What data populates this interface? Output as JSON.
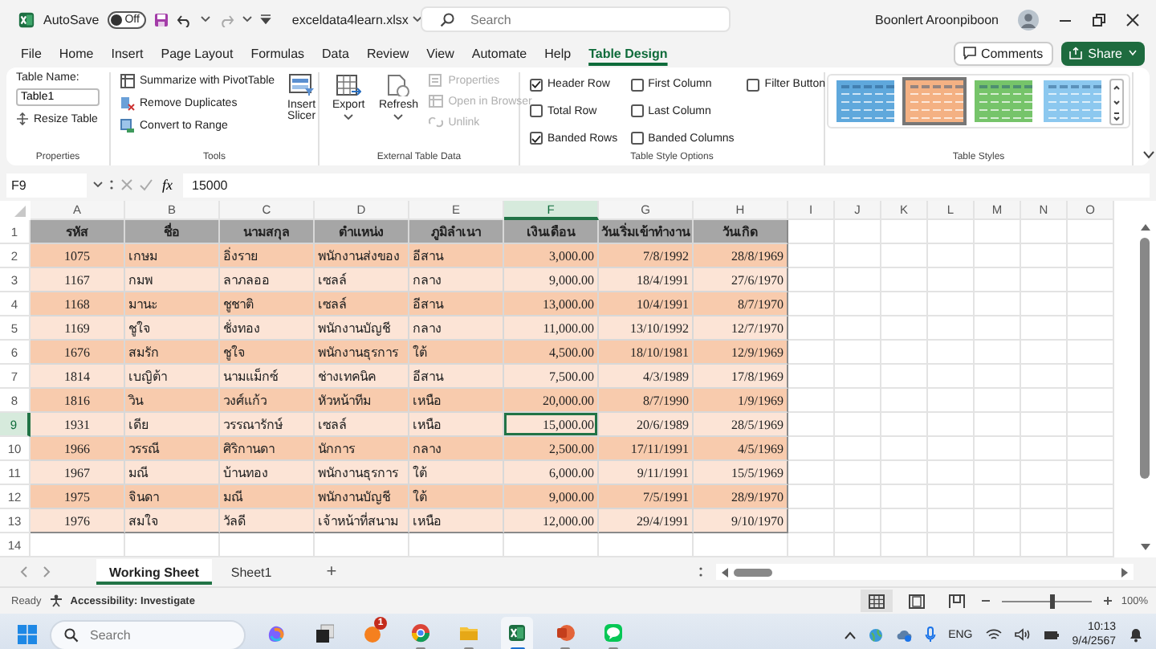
{
  "title_bar": {
    "autosave_label": "AutoSave",
    "autosave": {
      "label": "Off",
      "on": false
    },
    "filename": "exceldata4learn.xlsx",
    "search": {
      "placeholder": "Search"
    },
    "user": "Boonlert Aroonpiboon"
  },
  "menu_tabs": [
    {
      "label": "File",
      "selected": false
    },
    {
      "label": "Home",
      "selected": false
    },
    {
      "label": "Insert",
      "selected": false
    },
    {
      "label": "Page Layout",
      "selected": false
    },
    {
      "label": "Formulas",
      "selected": false
    },
    {
      "label": "Data",
      "selected": false
    },
    {
      "label": "Review",
      "selected": false
    },
    {
      "label": "View",
      "selected": false
    },
    {
      "label": "Automate",
      "selected": false
    },
    {
      "label": "Help",
      "selected": false
    },
    {
      "label": "Table Design",
      "selected": true
    }
  ],
  "actions": {
    "comments": "Comments",
    "share": "Share"
  },
  "ribbon": {
    "properties": {
      "table_name_label": "Table Name:",
      "table_name": "Table1",
      "resize": "Resize Table",
      "group": "Properties"
    },
    "tools": {
      "items": [
        "Summarize with PivotTable",
        "Remove Duplicates",
        "Convert to Range"
      ],
      "slicer": "Insert Slicer",
      "group": "Tools"
    },
    "external": {
      "buttons": [
        "Export",
        "Refresh"
      ],
      "items": [
        {
          "label": "Properties",
          "disabled": true
        },
        {
          "label": "Open in Browser",
          "disabled": true
        },
        {
          "label": "Unlink",
          "disabled": true
        }
      ],
      "group": "External Table Data"
    },
    "style_options": {
      "options": [
        {
          "label": "Header Row",
          "checked": true
        },
        {
          "label": "Total Row",
          "checked": false
        },
        {
          "label": "Banded Rows",
          "checked": true
        },
        {
          "label": "First Column",
          "checked": false
        },
        {
          "label": "Last Column",
          "checked": false
        },
        {
          "label": "Banded Columns",
          "checked": false
        },
        {
          "label": "Filter Button",
          "checked": false
        }
      ],
      "group": "Table Style Options"
    },
    "styles": {
      "swatches": [
        {
          "color": "#5fa8dc",
          "selected": false
        },
        {
          "color": "#f4b183",
          "selected": true
        },
        {
          "color": "#76c46a",
          "selected": false
        },
        {
          "color": "#8cc8ef",
          "selected": false
        }
      ],
      "group": "Table Styles"
    }
  },
  "formula_bar": {
    "name_box": "F9",
    "fx": "fx",
    "formula": "15000"
  },
  "sheet": {
    "columns": [
      {
        "label": "A",
        "selected": false
      },
      {
        "label": "B",
        "selected": false
      },
      {
        "label": "C",
        "selected": false
      },
      {
        "label": "D",
        "selected": false
      },
      {
        "label": "E",
        "selected": false
      },
      {
        "label": "F",
        "selected": true
      },
      {
        "label": "G",
        "selected": false
      },
      {
        "label": "H",
        "selected": false
      },
      {
        "label": "I",
        "selected": false
      },
      {
        "label": "J",
        "selected": false
      },
      {
        "label": "K",
        "selected": false
      },
      {
        "label": "L",
        "selected": false
      },
      {
        "label": "M",
        "selected": false
      },
      {
        "label": "N",
        "selected": false
      },
      {
        "label": "O",
        "selected": false
      }
    ],
    "rows": [
      {
        "label": "1",
        "selected": false
      },
      {
        "label": "2",
        "selected": false
      },
      {
        "label": "3",
        "selected": false
      },
      {
        "label": "4",
        "selected": false
      },
      {
        "label": "5",
        "selected": false
      },
      {
        "label": "6",
        "selected": false
      },
      {
        "label": "7",
        "selected": false
      },
      {
        "label": "8",
        "selected": false
      },
      {
        "label": "9",
        "selected": true
      },
      {
        "label": "10",
        "selected": false
      },
      {
        "label": "11",
        "selected": false
      },
      {
        "label": "12",
        "selected": false
      },
      {
        "label": "13",
        "selected": false
      },
      {
        "label": "14",
        "selected": false
      }
    ],
    "table": {
      "header": [
        "รหัส",
        "ชื่อ",
        "นามสกุล",
        "ตำแหน่ง",
        "ภูมิลำเนา",
        "เงินเดือน",
        "วันเริ่มเข้าทำงาน",
        "วันเกิด"
      ],
      "rows": [
        [
          "1075",
          "เกษม",
          "อิ่งราย",
          "พนักงานส่งของ",
          "อีสาน",
          "3,000.00",
          "7/8/1992",
          "28/8/1969"
        ],
        [
          "1167",
          "กมพ",
          "ลาภลออ",
          "เซลล์",
          "กลาง",
          "9,000.00",
          "18/4/1991",
          "27/6/1970"
        ],
        [
          "1168",
          "มานะ",
          "ชูชาติ",
          "เซลล์",
          "อีสาน",
          "13,000.00",
          "10/4/1991",
          "8/7/1970"
        ],
        [
          "1169",
          "ชูใจ",
          "ชั่งทอง",
          "พนักงานบัญชี",
          "กลาง",
          "11,000.00",
          "13/10/1992",
          "12/7/1970"
        ],
        [
          "1676",
          "สมรัก",
          "ชูใจ",
          "พนักงานธุรการ",
          "ใต้",
          "4,500.00",
          "18/10/1981",
          "12/9/1969"
        ],
        [
          "1814",
          "เบญิต้า",
          "นามแม็กซ์",
          "ช่างเทคนิค",
          "อีสาน",
          "7,500.00",
          "4/3/1989",
          "17/8/1969"
        ],
        [
          "1816",
          "วิน",
          "วงศ์แก้ว",
          "หัวหน้าทีม",
          "เหนือ",
          "20,000.00",
          "8/7/1990",
          "1/9/1969"
        ],
        [
          "1931",
          "เดีย",
          "วรรณารักษ์",
          "เซลล์",
          "เหนือ",
          "15,000.00",
          "20/6/1989",
          "28/5/1969"
        ],
        [
          "1966",
          "วรรณี",
          "ศิริกานดา",
          "นักการ",
          "กลาง",
          "2,500.00",
          "17/11/1991",
          "4/5/1969"
        ],
        [
          "1967",
          "มณี",
          "บ้านทอง",
          "พนักงานธุรการ",
          "ใต้",
          "6,000.00",
          "9/11/1991",
          "15/5/1969"
        ],
        [
          "1975",
          "จินดา",
          "มณี",
          "พนักงานบัญชี",
          "ใต้",
          "9,000.00",
          "7/5/1991",
          "28/9/1970"
        ],
        [
          "1976",
          "สมใจ",
          "วัลดี",
          "เจ้าหน้าที่สนาม",
          "เหนือ",
          "12,000.00",
          "29/4/1991",
          "9/10/1970"
        ]
      ]
    }
  },
  "sheet_tabs": [
    {
      "label": "Working Sheet",
      "selected": true
    },
    {
      "label": "Sheet1",
      "selected": false
    }
  ],
  "add_sheet": "+",
  "status_bar": {
    "status": "Ready",
    "accessibility": "Accessibility: Investigate",
    "views": [
      {
        "selected": true
      },
      {
        "selected": false
      },
      {
        "selected": false
      }
    ],
    "zoom": {
      "level": 0.55,
      "reading": "100%"
    }
  },
  "taskbar": {
    "search": {
      "placeholder": "Search"
    },
    "apps": [
      {
        "kind": "swirl",
        "running": false,
        "selected": false
      },
      {
        "kind": "stack",
        "running": false,
        "selected": false
      },
      {
        "kind": "circle",
        "running": false,
        "selected": false,
        "badge": "1"
      },
      {
        "kind": "browser",
        "running": true,
        "selected": false
      },
      {
        "kind": "folder",
        "running": true,
        "selected": false
      },
      {
        "kind": "sheet",
        "running": true,
        "selected": true
      },
      {
        "kind": "slides",
        "running": true,
        "selected": false
      },
      {
        "kind": "chat",
        "running": true,
        "selected": false
      }
    ],
    "language": "ENG",
    "time": "10:13",
    "date": "9/4/2567"
  }
}
